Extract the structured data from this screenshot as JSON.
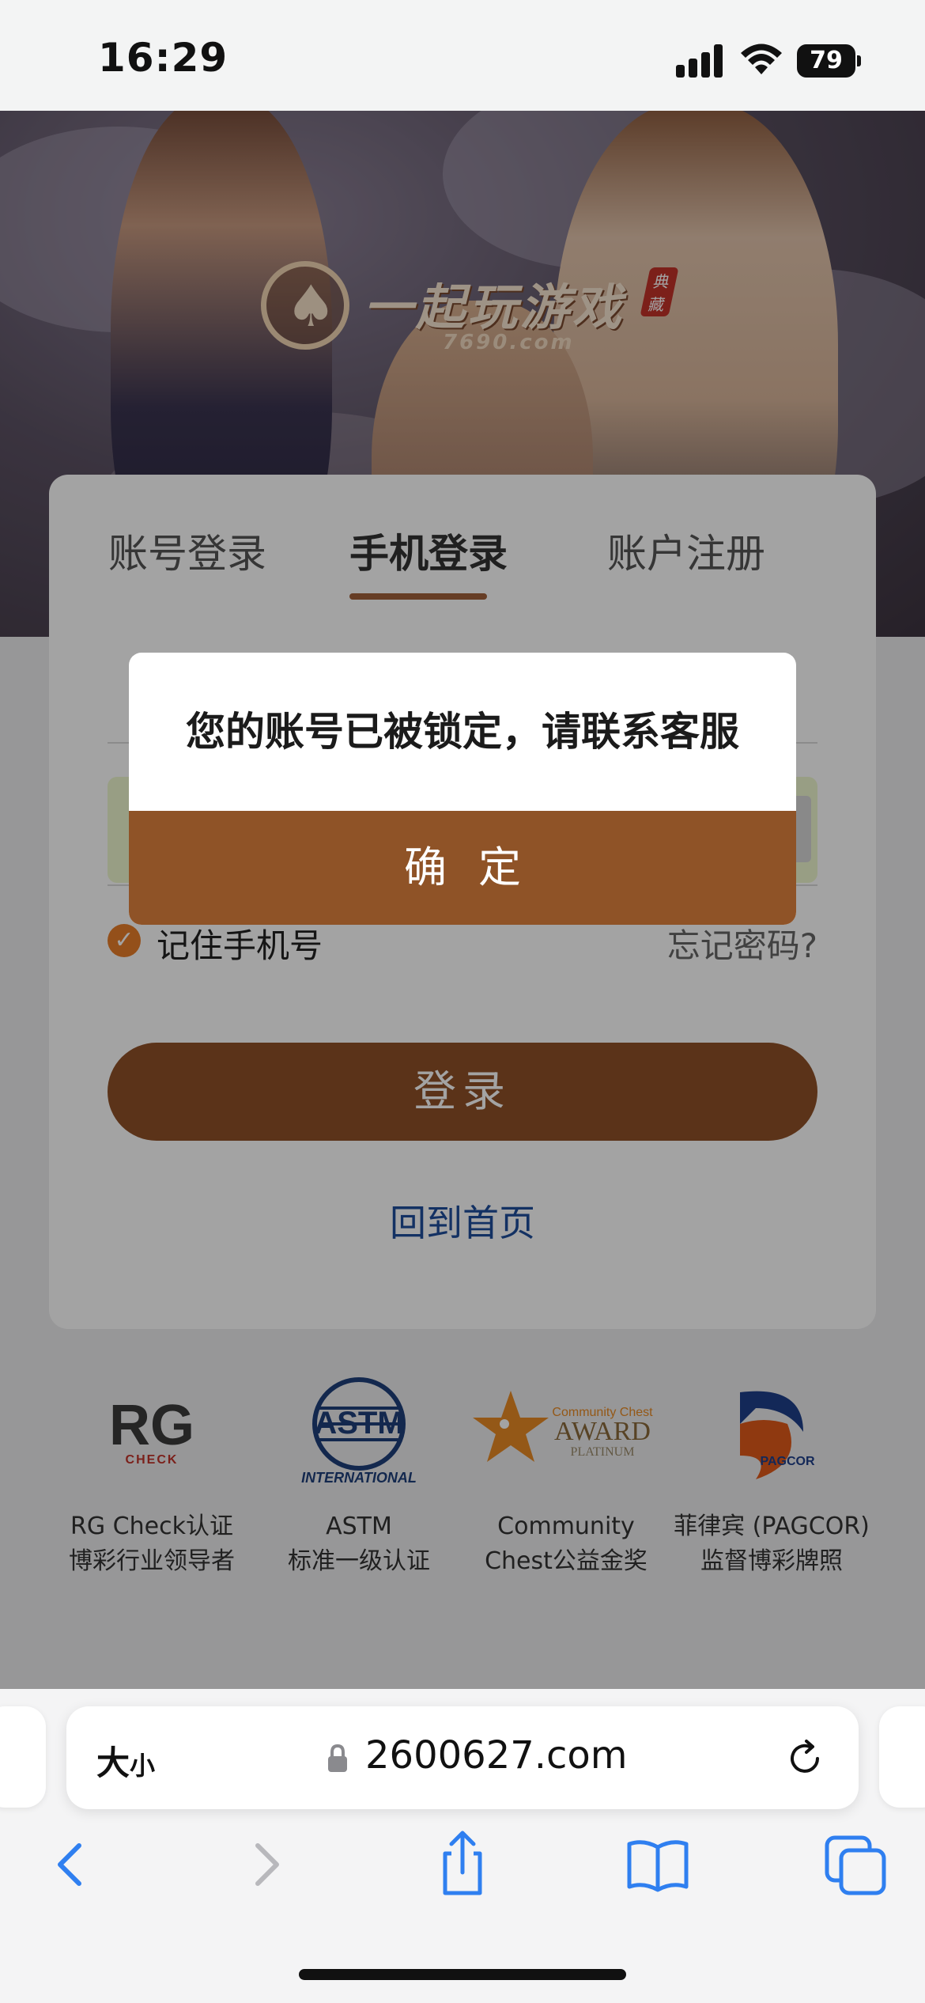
{
  "status_bar": {
    "time": "16:29",
    "battery": "79"
  },
  "hero": {
    "logo_title": "一起玩游戏",
    "logo_badge": "典藏",
    "logo_domain": "7690.com"
  },
  "login": {
    "tabs": [
      {
        "label": "账号登录",
        "active": false
      },
      {
        "label": "手机登录",
        "active": true
      },
      {
        "label": "账户注册",
        "active": false
      }
    ],
    "remember_label": "记住手机号",
    "remember_checked": true,
    "forgot_label": "忘记密码?",
    "login_button": "登录",
    "home_link": "回到首页"
  },
  "certifications": [
    {
      "logo": "RG",
      "logo_sub": "CHECK",
      "line1": "RG Check认证",
      "line2": "博彩行业领导者"
    },
    {
      "logo": "ASTM",
      "logo_sub": "INTERNATIONAL",
      "line1": "ASTM",
      "line2": "标准一级认证"
    },
    {
      "logo": "Community Chest",
      "logo_sub": "AWARD",
      "logo_sub2": "PLATINUM",
      "line1": "Community",
      "line2": "Chest公益金奖"
    },
    {
      "logo": "PAGCOR",
      "line1": "菲律宾 (PAGCOR)",
      "line2": "监督博彩牌照"
    }
  ],
  "alert": {
    "message": "您的账号已被锁定，请联系客服",
    "confirm": "确定"
  },
  "browser": {
    "text_size_label": "大",
    "text_size_small": "小",
    "url": "2600627.com",
    "toolbar": [
      "back-icon",
      "forward-icon",
      "share-icon",
      "bookmarks-icon",
      "tabs-icon"
    ]
  },
  "colors": {
    "brand_brown": "#8f5128",
    "link_blue": "#1f4e9c",
    "check_orange": "#e87d2a",
    "safari_blue": "#2f7ff0"
  }
}
